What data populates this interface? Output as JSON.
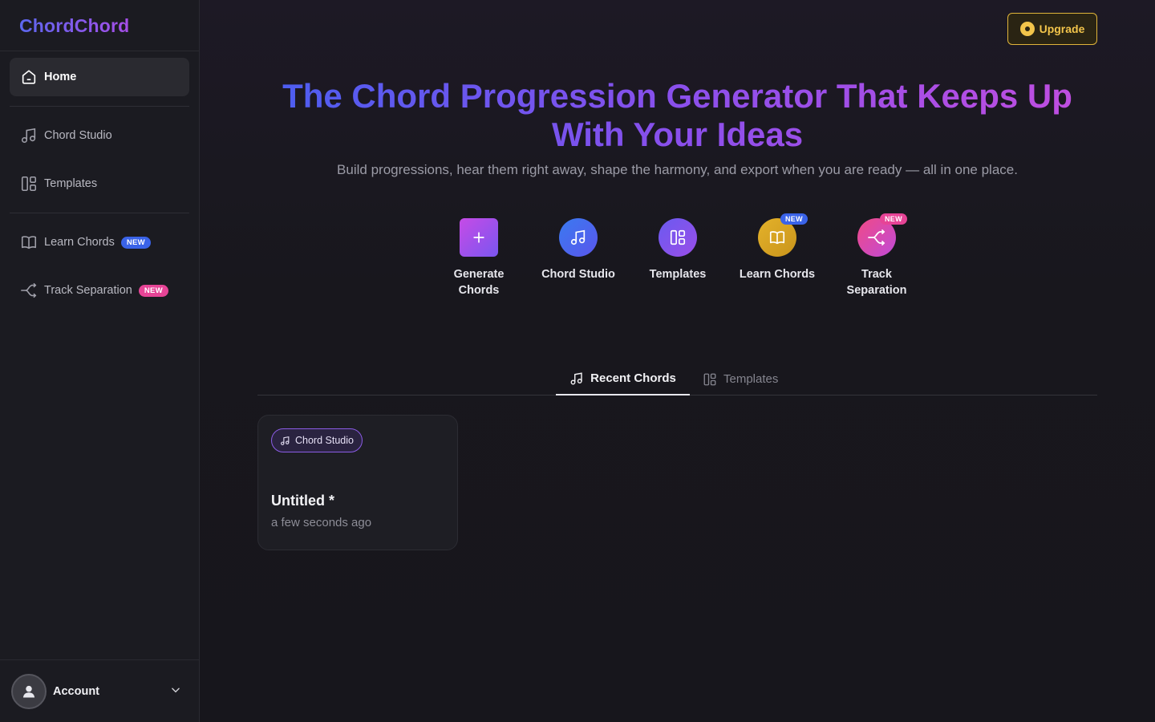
{
  "app": {
    "logo": "ChordChord"
  },
  "sidebar": {
    "items": [
      {
        "label": "Home",
        "icon": "home-icon"
      },
      {
        "label": "Chord Studio",
        "icon": "music-note-icon"
      },
      {
        "label": "Templates",
        "icon": "layout-icon"
      },
      {
        "label": "Learn Chords",
        "icon": "book-icon",
        "badge": "NEW"
      },
      {
        "label": "Track Separation",
        "icon": "split-icon",
        "badge": "NEW"
      }
    ],
    "account": {
      "label": "Account"
    }
  },
  "header": {
    "upgrade_label": "Upgrade"
  },
  "hero": {
    "title": "The Chord Progression Generator That Keeps Up With Your Ideas",
    "subtitle": "Build progressions, hear them right away, shape the harmony, and export when you are ready — all in one place."
  },
  "actions": [
    {
      "label": "Generate Chords",
      "icon": "plus-icon",
      "color": "#b44ae8"
    },
    {
      "label": "Chord Studio",
      "icon": "music-note-icon",
      "color": "#4f6cf0"
    },
    {
      "label": "Templates",
      "icon": "layout-icon",
      "color": "#8a52ec"
    },
    {
      "label": "Learn Chords",
      "icon": "book-icon",
      "color": "#e0a52a",
      "badge": "NEW"
    },
    {
      "label": "Track Separation",
      "icon": "split-icon",
      "color": "#e8458f",
      "badge": "NEW"
    }
  ],
  "tabs": [
    {
      "label": "Recent Chords",
      "active": true
    },
    {
      "label": "Templates",
      "active": false
    }
  ],
  "recent": [
    {
      "chip": "Chord Studio",
      "title": "Untitled *",
      "time": "a few seconds ago"
    }
  ]
}
